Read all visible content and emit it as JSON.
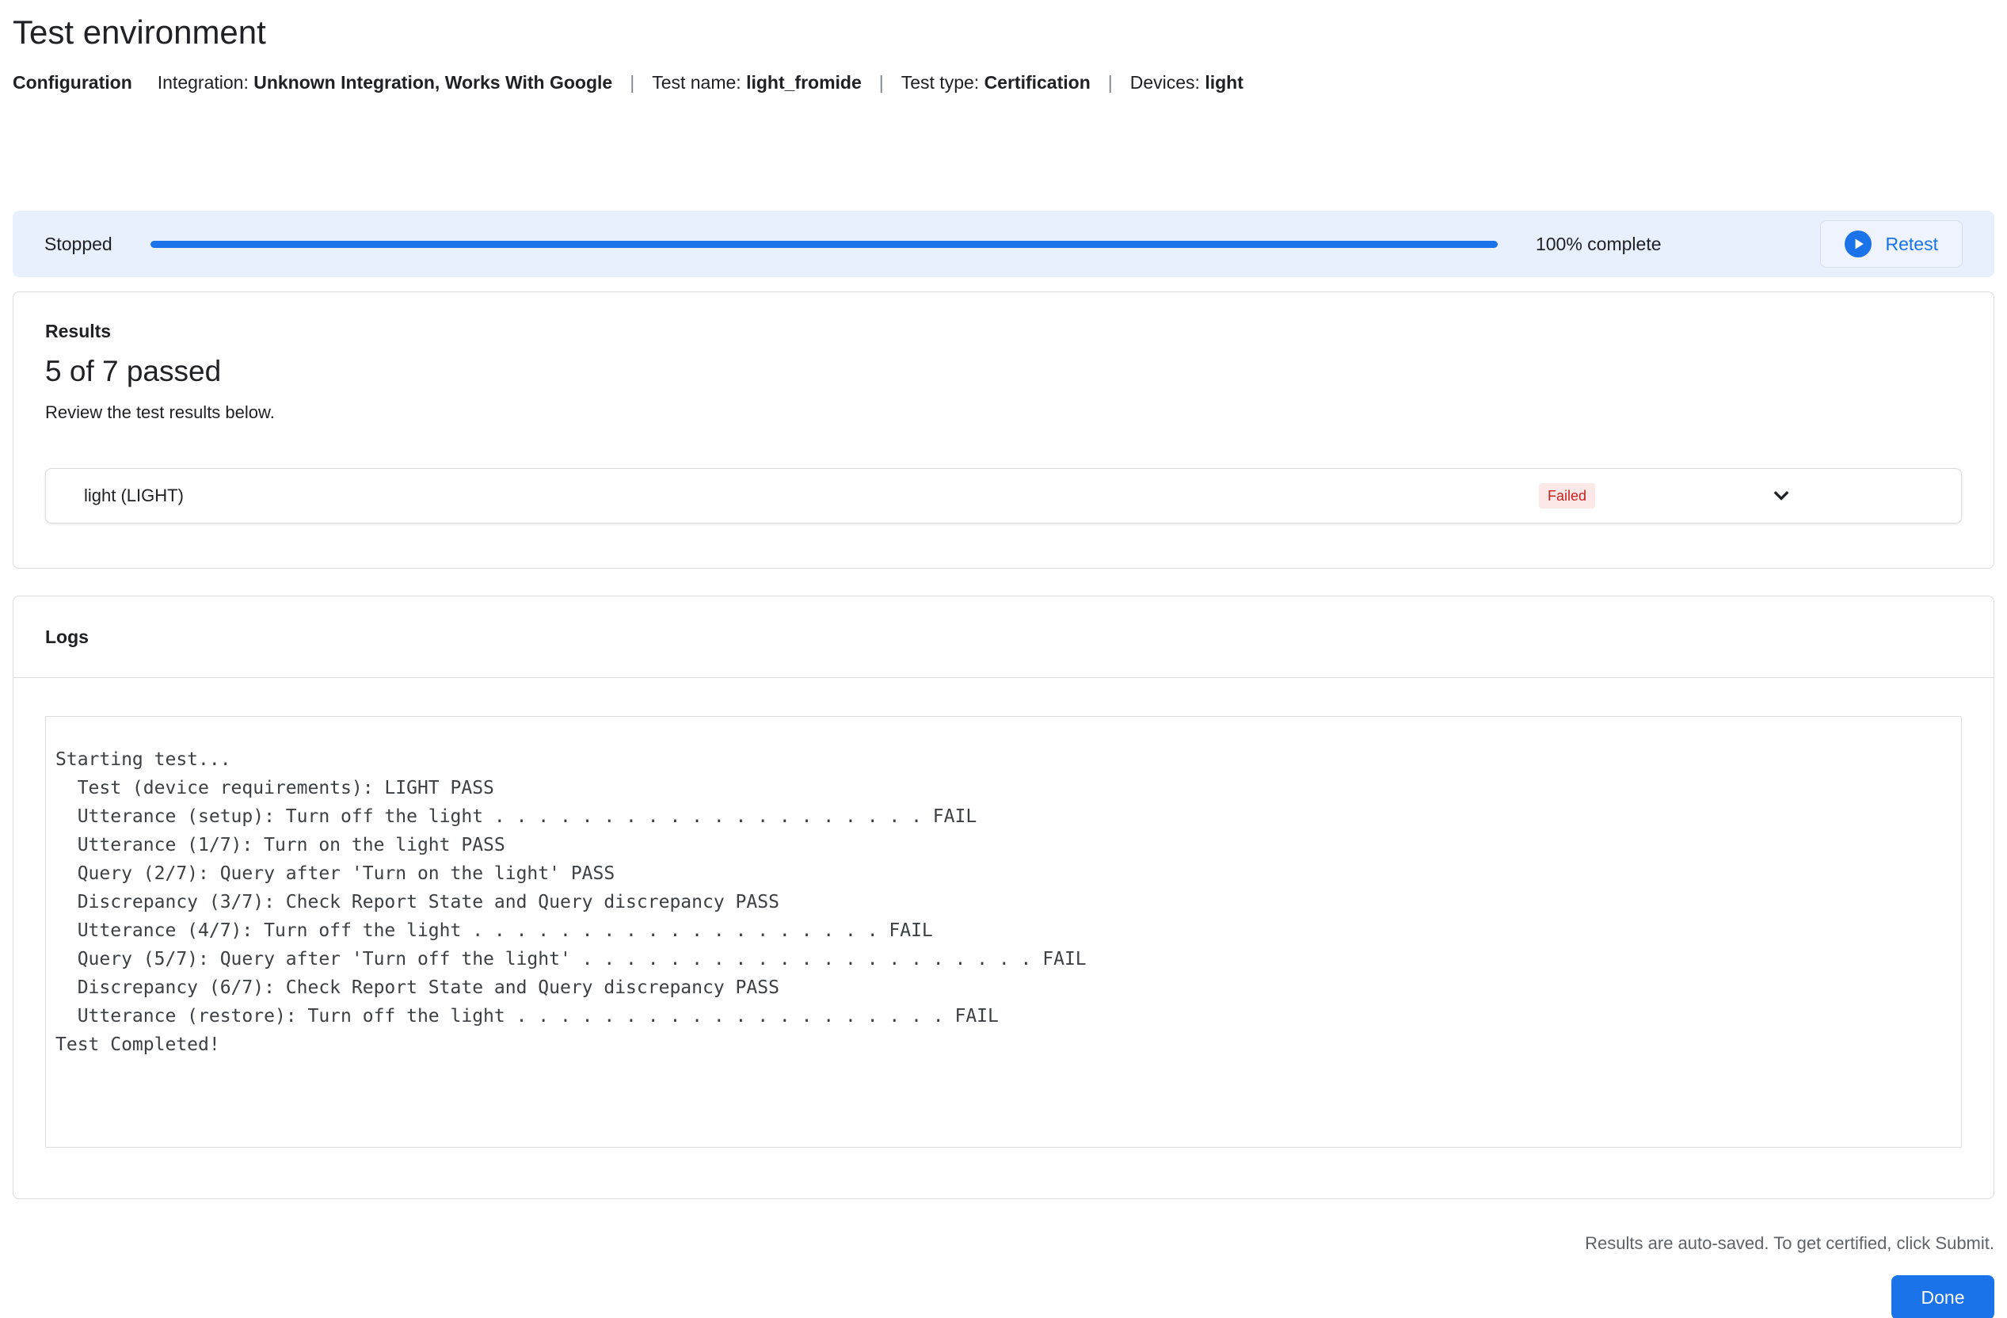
{
  "page": {
    "title": "Test environment"
  },
  "config": {
    "label": "Configuration",
    "separator": "|",
    "items": [
      {
        "label": "Integration: ",
        "value": "Unknown Integration, Works With Google"
      },
      {
        "label": "Test name: ",
        "value": "light_fromide"
      },
      {
        "label": "Test type: ",
        "value": "Certification"
      },
      {
        "label": "Devices: ",
        "value": "light"
      }
    ]
  },
  "progress": {
    "status": "Stopped",
    "percent": 100,
    "complete_label": "100% complete",
    "retest_label": "Retest"
  },
  "results": {
    "heading": "Results",
    "summary": "5 of 7 passed",
    "subtitle": "Review the test results below.",
    "rows": [
      {
        "name": "light (LIGHT)",
        "status": "Failed"
      }
    ]
  },
  "logs": {
    "heading": "Logs",
    "lines": [
      "Starting test...",
      "  Test (device requirements): LIGHT PASS",
      "  Utterance (setup): Turn off the light . . . . . . . . . . . . . . . . . . . . FAIL",
      "  Utterance (1/7): Turn on the light PASS",
      "  Query (2/7): Query after 'Turn on the light' PASS",
      "  Discrepancy (3/7): Check Report State and Query discrepancy PASS",
      "  Utterance (4/7): Turn off the light . . . . . . . . . . . . . . . . . . . FAIL",
      "  Query (5/7): Query after 'Turn off the light' . . . . . . . . . . . . . . . . . . . . . FAIL",
      "  Discrepancy (6/7): Check Report State and Query discrepancy PASS",
      "  Utterance (restore): Turn off the light . . . . . . . . . . . . . . . . . . . . FAIL",
      "Test Completed!"
    ]
  },
  "footer": {
    "note": "Results are auto-saved. To get certified, click Submit.",
    "done_label": "Done"
  },
  "colors": {
    "accent": "#1a73e8",
    "banner_bg": "#e8f0fe",
    "badge_bg": "#fce8e6",
    "badge_text": "#c5221f",
    "border": "#dadce0",
    "text": "#202124",
    "muted": "#5f6368"
  }
}
